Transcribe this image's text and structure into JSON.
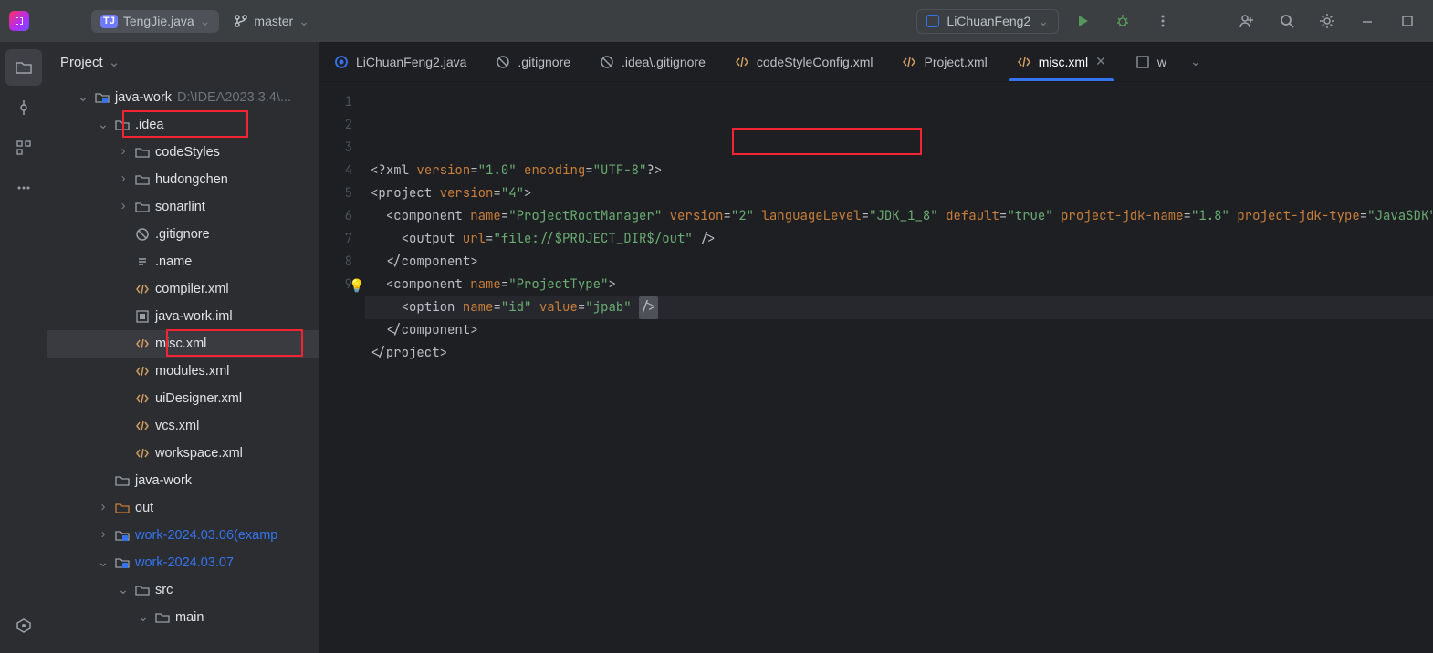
{
  "titlebar": {
    "current_file": "TengJie.java",
    "branch": "master",
    "run_config": "LiChuanFeng2"
  },
  "project_panel": {
    "title": "Project"
  },
  "tree": {
    "root_name": "java-work",
    "root_path": "D:\\IDEA2023.3.4\\...",
    "idea_folder": ".idea",
    "items": [
      {
        "name": "codeStyles",
        "type": "folder",
        "indent": 3,
        "arrow": ">"
      },
      {
        "name": "hudongchen",
        "type": "folder",
        "indent": 3,
        "arrow": ">"
      },
      {
        "name": "sonarlint",
        "type": "folder",
        "indent": 3,
        "arrow": ">"
      },
      {
        "name": ".gitignore",
        "type": "ignore",
        "indent": 3
      },
      {
        "name": ".name",
        "type": "text",
        "indent": 3
      },
      {
        "name": "compiler.xml",
        "type": "xml",
        "indent": 3
      },
      {
        "name": "java-work.iml",
        "type": "iml",
        "indent": 3
      },
      {
        "name": "misc.xml",
        "type": "xml",
        "indent": 3,
        "selected": true,
        "redbox": true
      },
      {
        "name": "modules.xml",
        "type": "xml",
        "indent": 3
      },
      {
        "name": "uiDesigner.xml",
        "type": "xml",
        "indent": 3
      },
      {
        "name": "vcs.xml",
        "type": "xml",
        "indent": 3
      },
      {
        "name": "workspace.xml",
        "type": "xml",
        "indent": 3
      }
    ],
    "after": [
      {
        "name": "java-work",
        "type": "folder",
        "indent": 2
      },
      {
        "name": "out",
        "type": "folder-orange",
        "indent": 2,
        "arrow": ">"
      },
      {
        "name": "work-2024.03.06(examp",
        "type": "module",
        "indent": 2,
        "arrow": ">",
        "vcs": true
      },
      {
        "name": "work-2024.03.07",
        "type": "module",
        "indent": 2,
        "arrow": "v",
        "vcs": true
      },
      {
        "name": "src",
        "type": "folder",
        "indent": 3,
        "arrow": "v"
      },
      {
        "name": "main",
        "type": "folder",
        "indent": 4,
        "arrow": "v"
      }
    ]
  },
  "tabs": [
    {
      "label": "LiChuanFeng2.java",
      "icon": "ring-blue",
      "active": false
    },
    {
      "label": ".gitignore",
      "icon": "ignore",
      "active": false
    },
    {
      "label": ".idea\\.gitignore",
      "icon": "ignore",
      "active": false
    },
    {
      "label": "codeStyleConfig.xml",
      "icon": "code",
      "active": false
    },
    {
      "label": "Project.xml",
      "icon": "code",
      "active": false
    },
    {
      "label": "misc.xml",
      "icon": "code",
      "active": true,
      "closeable": true
    },
    {
      "label": "w",
      "icon": "code-square",
      "active": false,
      "truncated": true
    }
  ],
  "editor": {
    "lines": [
      {
        "n": 1,
        "html": "<span class='t-punc'>&lt;?</span><span class='t-tag'>xml </span><span class='t-attr'>version</span><span class='t-punc'>=</span><span class='t-str'>\"1.0\"</span> <span class='t-attr'>encoding</span><span class='t-punc'>=</span><span class='t-str'>\"UTF-8\"</span><span class='t-punc'>?&gt;</span>"
      },
      {
        "n": 2,
        "html": "<span class='t-punc'>&lt;</span><span class='t-tag'>project </span><span class='t-attr'>version</span><span class='t-punc'>=</span><span class='t-str'>\"4\"</span><span class='t-punc'>&gt;</span>"
      },
      {
        "n": 3,
        "html": "  <span class='t-punc'>&lt;</span><span class='t-tag'>component </span><span class='t-attr'>name</span><span class='t-punc'>=</span><span class='t-str'>\"ProjectRootManager\"</span> <span class='t-attr'>version</span><span class='t-punc'>=</span><span class='t-str'>\"2\"</span> <span class='t-attr'>languageLevel</span><span class='t-punc'>=</span><span class='t-str'>\"JDK_1_8\"</span> <span class='t-attr'>default</span><span class='t-punc'>=</span><span class='t-str'>\"true\"</span> <span class='t-attr'>project-jdk-name</span><span class='t-punc'>=</span><span class='t-str'>\"1.8\"</span> <span class='t-attr'>project-jdk-type</span><span class='t-punc'>=</span><span class='t-str'>\"JavaSDK\"</span><span class='t-punc'>&gt;</span>"
      },
      {
        "n": 4,
        "html": "    <span class='t-punc'>&lt;</span><span class='t-tag'>output </span><span class='t-attr'>url</span><span class='t-punc'>=</span><span class='t-str'>\"file://$PROJECT_DIR$/out\"</span> <span class='t-punc'>/&gt;</span>"
      },
      {
        "n": 5,
        "html": "  <span class='t-punc'>&lt;/</span><span class='t-tag'>component</span><span class='t-punc'>&gt;</span>"
      },
      {
        "n": 6,
        "html": "  <span class='t-punc'>&lt;</span><span class='t-tag'>component </span><span class='t-attr'>name</span><span class='t-punc'>=</span><span class='t-str'>\"ProjectType\"</span><span class='t-punc'>&gt;</span>",
        "bulb": true
      },
      {
        "n": 7,
        "html": "    <span class='t-punc'>&lt;</span><span class='t-tag'>option </span><span class='t-attr'>name</span><span class='t-punc'>=</span><span class='t-str'>\"id\"</span> <span class='t-attr'>value</span><span class='t-punc'>=</span><span class='t-str'>\"jpab\"</span> <span class='caret-box t-punc'>/&gt;</span>",
        "current": true
      },
      {
        "n": 8,
        "html": "  <span class='t-punc'>&lt;/</span><span class='t-tag'>component</span><span class='t-punc'>&gt;</span>"
      },
      {
        "n": 9,
        "html": "<span class='t-punc'>&lt;/</span><span class='t-tag'>project</span><span class='t-punc'>&gt;</span>"
      }
    ]
  }
}
